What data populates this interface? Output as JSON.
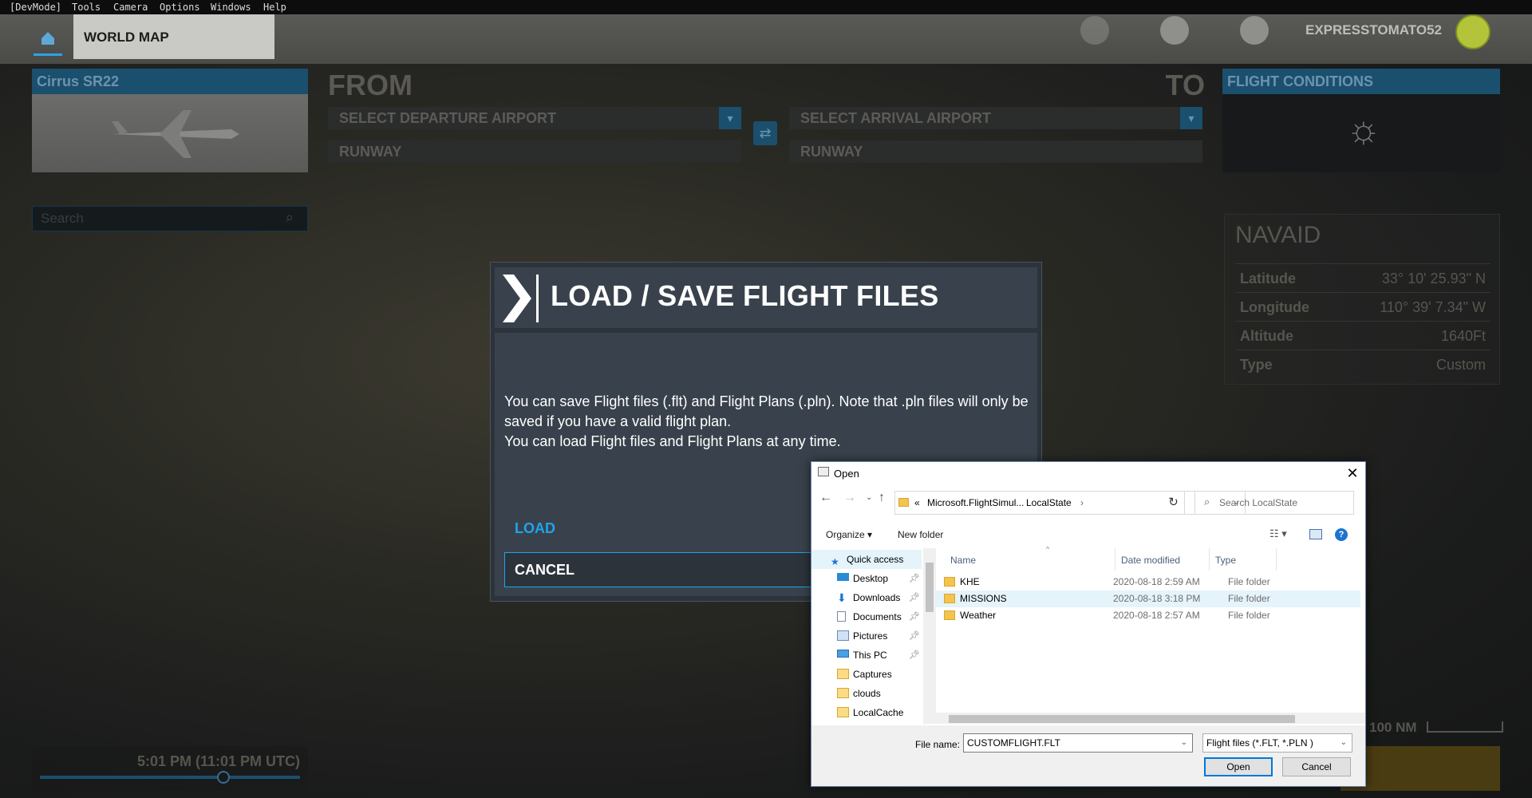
{
  "devmenu": [
    "[DevMode]",
    "Tools",
    "Camera",
    "Options",
    "Windows",
    "Help"
  ],
  "nav": {
    "tab": "WORLD MAP",
    "username": "EXPRESSTOMATO52"
  },
  "aircraft": {
    "name": "Cirrus SR22"
  },
  "route": {
    "from": "FROM",
    "to": "TO",
    "departure_placeholder": "SELECT DEPARTURE AIRPORT",
    "arrival_placeholder": "SELECT ARRIVAL AIRPORT",
    "runway1": "RUNWAY",
    "runway2": "RUNWAY"
  },
  "conditions": {
    "title": "FLIGHT CONDITIONS"
  },
  "search": {
    "placeholder": "Search"
  },
  "navaid": {
    "title": "NAVAID",
    "rows": [
      {
        "k": "Latitude",
        "v": "33° 10' 25.93\" N"
      },
      {
        "k": "Longitude",
        "v": "110° 39' 7.34\" W"
      },
      {
        "k": "Altitude",
        "v": "1640Ft"
      },
      {
        "k": "Type",
        "v": "Custom"
      }
    ]
  },
  "time": {
    "text": "5:01 PM (11:01 PM UTC)",
    "slider_fraction": 0.71
  },
  "scale": {
    "text": "100 NM"
  },
  "modal": {
    "title": "LOAD / SAVE FLIGHT FILES",
    "line1": "You can save Flight files (.flt) and Flight Plans (.pln). Note that .pln files will only be saved if you have a valid flight plan.",
    "line2": "You can load Flight files and Flight Plans at any time.",
    "load": "LOAD",
    "cancel": "CANCEL"
  },
  "dialog": {
    "title": "Open",
    "path_prefix": "«",
    "path_1": "Microsoft.FlightSimul...",
    "path_2": "LocalState",
    "search_placeholder": "Search LocalState",
    "organize": "Organize",
    "new_folder": "New folder",
    "nav_items": [
      {
        "label": "Quick access",
        "icon": "star-icon",
        "pinned": false
      },
      {
        "label": "Desktop",
        "icon": "desktop-icon",
        "pinned": true
      },
      {
        "label": "Downloads",
        "icon": "download-icon",
        "pinned": true
      },
      {
        "label": "Documents",
        "icon": "documents-icon",
        "pinned": true
      },
      {
        "label": "Pictures",
        "icon": "pictures-icon",
        "pinned": true
      },
      {
        "label": "This PC",
        "icon": "pc-icon",
        "pinned": true
      },
      {
        "label": "Captures",
        "icon": "folder-icon",
        "pinned": false
      },
      {
        "label": "clouds",
        "icon": "folder-icon",
        "pinned": false
      },
      {
        "label": "LocalCache",
        "icon": "folder-icon",
        "pinned": false
      }
    ],
    "columns": {
      "name": "Name",
      "date": "Date modified",
      "type": "Type"
    },
    "files": [
      {
        "name": "KHE",
        "date": "2020-08-18 2:59 AM",
        "type": "File folder"
      },
      {
        "name": "MISSIONS",
        "date": "2020-08-18 3:18 PM",
        "type": "File folder"
      },
      {
        "name": "Weather",
        "date": "2020-08-18 2:57 AM",
        "type": "File folder"
      }
    ],
    "file_name_label": "File name:",
    "file_name_value": "CUSTOMFLIGHT.FLT",
    "file_type": "Flight files (*.FLT, *.PLN )",
    "open_btn": "Open",
    "cancel_btn": "Cancel"
  },
  "colors": {
    "accent": "#1ea5ea",
    "panel_blue": "#1b4f6e",
    "modal_bg": "#39424c"
  }
}
